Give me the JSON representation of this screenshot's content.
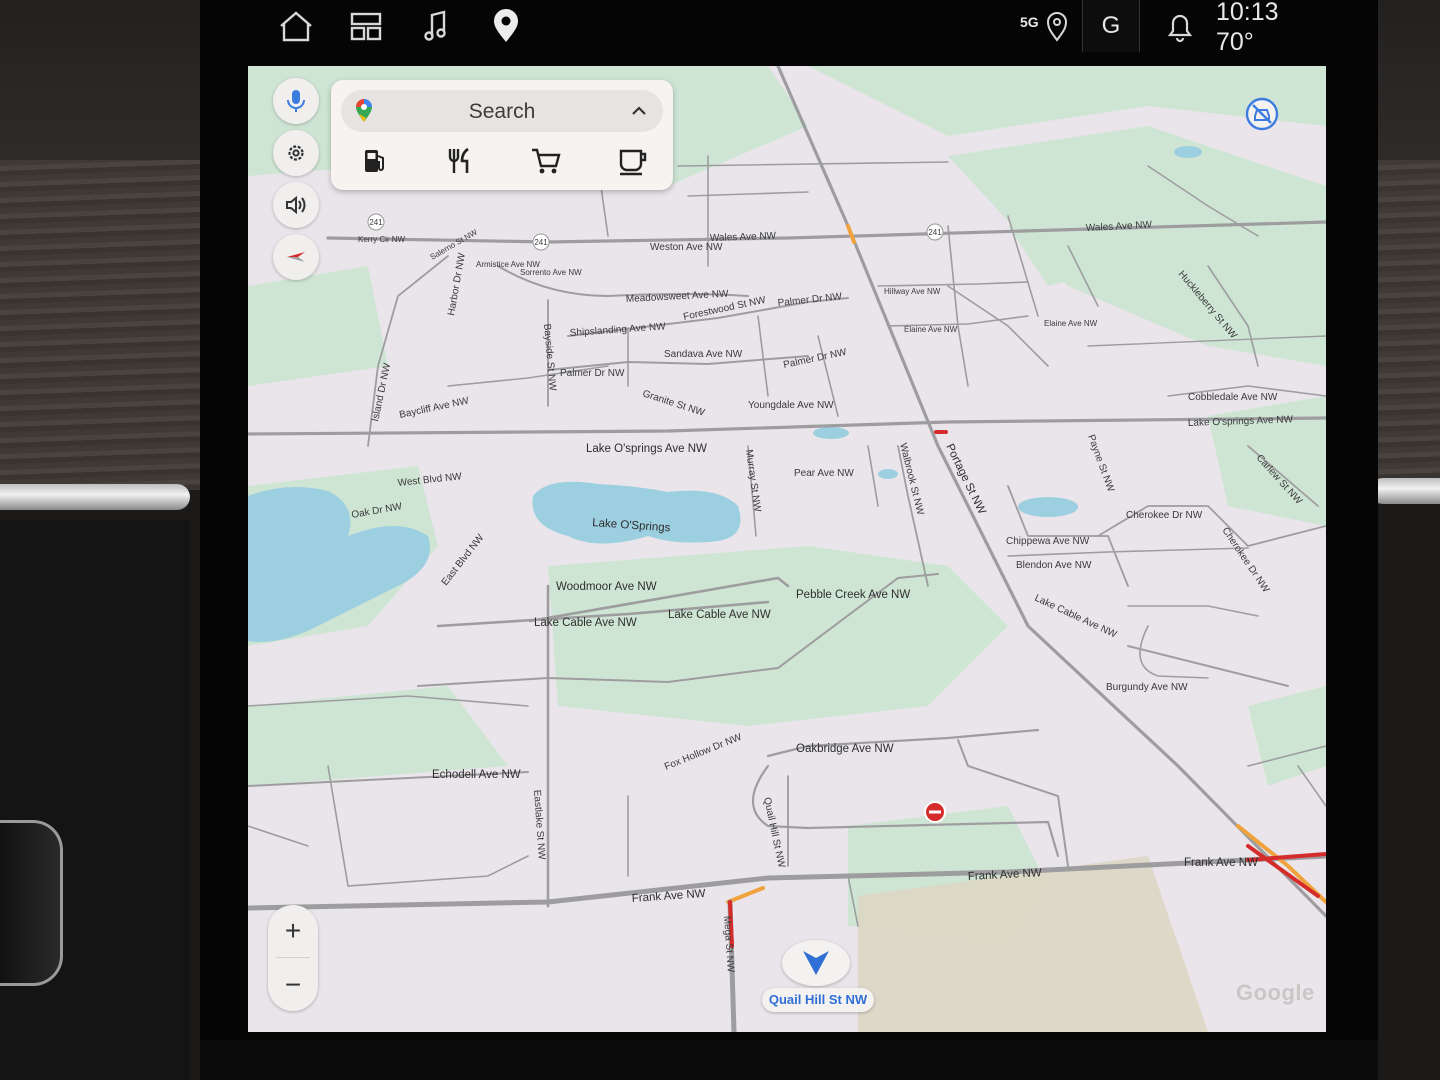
{
  "status_bar": {
    "network": "5G",
    "profile_initial": "G",
    "time": "10:13",
    "temperature": "70°",
    "nav_icons": [
      "home-icon",
      "apps-grid-icon",
      "music-note-icon",
      "location-pin-icon"
    ]
  },
  "search": {
    "label": "Search",
    "categories": [
      "gas-station-icon",
      "restaurant-icon",
      "shopping-cart-icon",
      "coffee-icon"
    ]
  },
  "side_controls": [
    "microphone-icon",
    "settings-gear-icon",
    "volume-icon",
    "compass-icon"
  ],
  "zoom": {
    "in_label": "+",
    "out_label": "−"
  },
  "current_street": "Quail Hill St NW",
  "attribution": "Google",
  "map_labels": {
    "wales_ave_w": "Wales Ave NW",
    "wales_ave_e": "Wales Ave NW",
    "weston": "Weston Ave NW",
    "kerry_cir": "Kerry Cir NW",
    "salerno": "Salerno St NW",
    "armistice": "Armistice Ave NW",
    "sorrento": "Sorrento Ave NW",
    "harbor": "Harbor Dr NW",
    "meadowsweet": "Meadowsweet Ave NW",
    "forestwood": "Forestwood St NW",
    "palmer_top": "Palmer Dr NW",
    "palmer_mid": "Palmer Dr NW",
    "palmer_left": "Palmer Dr NW",
    "shipslanding": "Shipslanding Ave NW",
    "sandava": "Sandava Ave NW",
    "bayside": "Bayside St NW",
    "island": "Island Dr NW",
    "baycliff": "Baycliff Ave NW",
    "granite": "Granite St NW",
    "youngdale": "Youngdale Ave NW",
    "lake_ospringsave": "Lake O'springs Ave NW",
    "lake_ospringsave_e": "Lake O'springs Ave NW",
    "west_blvd": "West Blvd NW",
    "oak_dr": "Oak Dr NW",
    "lake_ospringslake": "Lake O'Springs",
    "murray": "Murray St NW",
    "pear": "Pear Ave NW",
    "walbrook": "Walbrook St NW",
    "portage": "Portage St NW",
    "east_blvd": "East Blvd NW",
    "woodmoor": "Woodmoor Ave NW",
    "lake_cable_w": "Lake Cable Ave NW",
    "lake_cable_m": "Lake Cable Ave NW",
    "lake_cable_e": "Lake Cable Ave NW",
    "pebble_creek": "Pebble Creek Ave NW",
    "chippewa": "Chippewa Ave NW",
    "blendon": "Blendon Ave NW",
    "cherokee": "Cherokee Dr NW",
    "cherokee_2": "Cherokee Dr NW",
    "cobbledale": "Cobbledale Ave NW",
    "carlew": "Carlew St NW",
    "paynes": "Payne St NW",
    "burgundy": "Burgundy Ave NW",
    "elaine_w": "Elaine Ave NW",
    "elaine_e": "Elaine Ave NW",
    "hillway": "Hillway Ave NW",
    "huckleberry": "Huckleberry St NW",
    "fox_hollow": "Fox Hollow Dr NW",
    "oakbridge": "Oakbridge Ave NW",
    "quail_hill": "Quail Hill St NW",
    "echodell": "Echodell Ave NW",
    "eastlake": "Eastlake St NW",
    "frank_w": "Frank Ave NW",
    "frank_m": "Frank Ave NW",
    "frank_e": "Frank Ave NW",
    "mega": "Mega St NW",
    "route_241_a": "241",
    "route_241_b": "241",
    "route_241_c": "241"
  },
  "colors": {
    "map_base": "#e9e5ea",
    "park": "#cfe5d4",
    "water": "#9ccfe0",
    "road": "#9d9d9f",
    "traffic_red": "#d62b2b",
    "traffic_orange": "#f0a23c",
    "accent_blue": "#2f6fd6"
  }
}
